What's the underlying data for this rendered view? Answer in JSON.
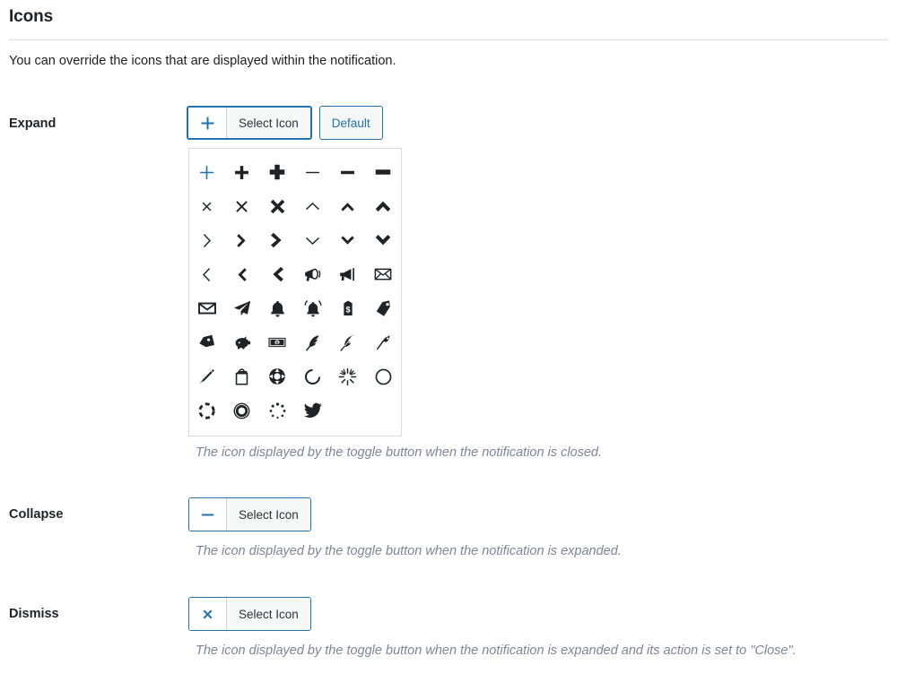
{
  "header": {
    "title": "Icons",
    "description": "You can override the icons that are displayed within the notification."
  },
  "colors": {
    "accent": "#2271b1",
    "text": "#1e1e1e",
    "help_text": "#7c8694",
    "border": "#dcdcde",
    "button_bg": "#f6f7f7"
  },
  "fields": [
    {
      "label": "Expand",
      "button_label": "Select Icon",
      "button_icon": "plus-icon",
      "default_label": "Default",
      "has_default": true,
      "focused": true,
      "help": "The icon displayed by the toggle button when the notification is closed.",
      "picker_open": true
    },
    {
      "label": "Collapse",
      "button_label": "Select Icon",
      "button_icon": "minus-icon",
      "has_default": false,
      "focused": false,
      "help": "The icon displayed by the toggle button when the notification is expanded.",
      "picker_open": false
    },
    {
      "label": "Dismiss",
      "button_label": "Select Icon",
      "button_icon": "times-icon",
      "has_default": false,
      "focused": false,
      "help": "The icon displayed by the toggle button when the notification is expanded and its action is set to \"Close\".",
      "picker_open": false
    }
  ],
  "icon_picker": {
    "selected_index": 0,
    "columns": 6,
    "icons": [
      "plus-thin-icon",
      "plus-medium-icon",
      "plus-bold-icon",
      "minus-thin-icon",
      "minus-medium-icon",
      "minus-bold-icon",
      "times-thin-icon",
      "times-medium-icon",
      "times-bold-icon",
      "chevron-up-thin-icon",
      "chevron-up-medium-icon",
      "chevron-up-bold-icon",
      "chevron-right-thin-icon",
      "chevron-right-medium-icon",
      "chevron-right-bold-icon",
      "chevron-down-thin-icon",
      "chevron-down-medium-icon",
      "chevron-down-bold-icon",
      "chevron-left-thin-icon",
      "chevron-left-medium-icon",
      "chevron-left-bold-icon",
      "megaphone-icon",
      "bullhorn-icon",
      "envelope-open-icon",
      "envelope-icon",
      "paper-plane-icon",
      "bell-icon",
      "bell-ringing-icon",
      "price-tag-dollar-icon",
      "tag-icon",
      "tag-alt-icon",
      "piggy-bank-icon",
      "money-bill-icon",
      "feather-icon",
      "feather-alt-icon",
      "pen-nib-icon",
      "pencil-icon",
      "shopping-bag-icon",
      "life-ring-icon",
      "spinner-notch-icon",
      "spinner-sun-icon",
      "circle-outline-icon",
      "spinner-dashed-icon",
      "donut-ring-icon",
      "spinner-dotted-icon",
      "twitter-icon"
    ]
  }
}
